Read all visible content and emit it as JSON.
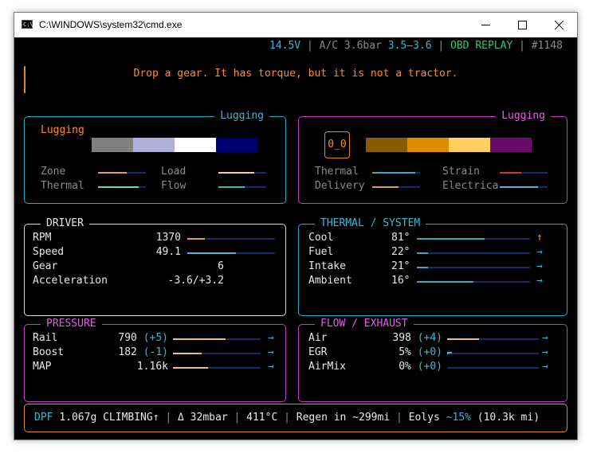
{
  "window": {
    "title": "C:\\WINDOWS\\system32\\cmd.exe",
    "icon": "cmd-icon",
    "icon_text": "C:\\"
  },
  "status": {
    "voltage": "14.5V",
    "ac": "A/C 3.6bar",
    "ac_range": "3.5–3.6",
    "mode": "OBD REPLAY",
    "frame": "#1148"
  },
  "message": "Drop a gear. It has torque, but it is not a tractor.",
  "lugging_left": {
    "title": "Lugging",
    "label": "Lugging",
    "swatches": [
      "#808080",
      "#b0b0dc",
      "#ffffff",
      "#000070"
    ],
    "indicators": [
      {
        "label": "Zone",
        "level": 0.6,
        "color": "#d9a066"
      },
      {
        "label": "Load",
        "level": 0.75,
        "color": "#e6d6a8"
      },
      {
        "label": "Thermal",
        "level": 0.85,
        "color": "#66d9c2"
      },
      {
        "label": "Flow",
        "level": 0.55,
        "color": "#3fb8a8"
      }
    ]
  },
  "lugging_right": {
    "title": "Lugging",
    "face": "0_0",
    "swatches": [
      "#8a5c00",
      "#e08c00",
      "#ffd060",
      "#6a0a6a"
    ],
    "indicators": [
      {
        "label": "Thermal",
        "level": 0.9,
        "color": "#3fa8c2"
      },
      {
        "label": "Strain",
        "level": 0.45,
        "color": "#d04020"
      },
      {
        "label": "Delivery",
        "level": 0.55,
        "color": "#d9a066"
      },
      {
        "label": "Electrica",
        "level": 0.8,
        "color": "#5ab0d8"
      }
    ]
  },
  "driver": {
    "title": "DRIVER",
    "rows": [
      {
        "label": "RPM",
        "value": "1370",
        "level": 0.2,
        "color": "#d9a066"
      },
      {
        "label": "Speed",
        "value": "49.1",
        "level": 0.55,
        "color": "#5ab0d8"
      },
      {
        "label": "Gear",
        "value": "6"
      },
      {
        "label": "Acceleration",
        "value": "-3.6/+3.2"
      }
    ]
  },
  "thermal": {
    "title": "THERMAL / SYSTEM",
    "rows": [
      {
        "label": "Cool",
        "value": "81°",
        "level": 0.6,
        "color": "#3fa8c2",
        "trend": "↑"
      },
      {
        "label": "Fuel",
        "value": "22°",
        "level": 0.1,
        "color": "#3fa8c2",
        "trend": "→"
      },
      {
        "label": "Intake",
        "value": "21°",
        "level": 0.1,
        "color": "#3fa8c2",
        "trend": "→"
      },
      {
        "label": "Ambient",
        "value": "16°",
        "level": 0.5,
        "color": "#3fa8c2",
        "trend": "→"
      }
    ]
  },
  "pressure": {
    "title": "PRESSURE",
    "rows": [
      {
        "label": "Rail",
        "value": "790",
        "delta": "(+5)",
        "level": 0.6,
        "color": "#e6c280",
        "trend": "→"
      },
      {
        "label": "Boost",
        "value": "182",
        "delta": "(-1)",
        "level": 0.33,
        "color": "#e6c280",
        "trend": "→"
      },
      {
        "label": "MAP",
        "value": "1.16k",
        "delta": "",
        "level": 0.4,
        "color": "#e6c280",
        "trend": "→"
      }
    ]
  },
  "flow": {
    "title": "FLOW / EXHAUST",
    "rows": [
      {
        "label": "Air",
        "value": "398",
        "delta": "(+4)",
        "level": 0.35,
        "color": "#e6c280",
        "trend": "→"
      },
      {
        "label": "EGR",
        "value": "5%",
        "delta": "(+0)",
        "level": 0.02,
        "color": "#3ab8d6",
        "trend": "→"
      },
      {
        "label": "AirMix",
        "value": "0%",
        "delta": "(+0)",
        "level": 0.0,
        "color": "#3ab8d6",
        "trend": "→"
      }
    ]
  },
  "footer": {
    "dpf_label": "DPF",
    "dpf_value": "1.067g CLIMBING↑",
    "delta": "Δ 32mbar",
    "temp": "411°C",
    "regen": "Regen in ~299mi",
    "eolys_label": "Eolys",
    "eolys_pct": "~15%",
    "eolys_rest": "(10.3k mi)"
  },
  "colors": {
    "cyan_border": "#2aa8c8",
    "magenta_border": "#c040c0",
    "white_border": "#d8d8d8",
    "orange_border": "#e08a30"
  }
}
